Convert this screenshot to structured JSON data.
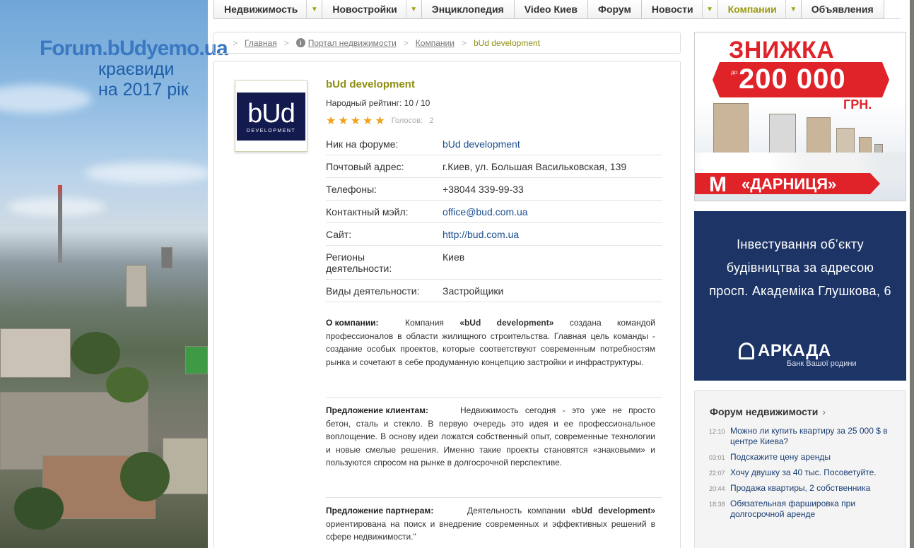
{
  "brand": {
    "site": "Forum.bUdyemo.ua",
    "tagline_line1": "краєвиди",
    "tagline_line2": "на 2017 рік"
  },
  "nav": [
    {
      "label": "Недвижимость",
      "arrow": true,
      "active": false
    },
    {
      "label": "Новостройки",
      "arrow": true,
      "active": false
    },
    {
      "label": "Энциклопедия",
      "arrow": false,
      "active": false
    },
    {
      "label": "Video Киев",
      "arrow": false,
      "active": false
    },
    {
      "label": "Форум",
      "arrow": false,
      "active": false
    },
    {
      "label": "Новости",
      "arrow": true,
      "active": false
    },
    {
      "label": "Компании",
      "arrow": true,
      "active": true
    },
    {
      "label": "Объявления",
      "arrow": false,
      "active": false
    }
  ],
  "breadcrumb": {
    "home": "Главная",
    "portal": "Портал недвижимости",
    "companies": "Компании",
    "current": "bUd development"
  },
  "company": {
    "name": "bUd development",
    "logo_big": "bUd",
    "logo_small": "DEVELOPMENT",
    "rating_label": "Народный рейтинг:",
    "rating_value": "10 / 10",
    "stars": 5,
    "votes_label": "Голосов:",
    "votes": "2",
    "fields": [
      {
        "key": "Ник на форуме:",
        "value": "bUd development",
        "link": true
      },
      {
        "key": "Почтовый адрес:",
        "value": "г.Киев, ул. Большая Васильковская, 139",
        "link": false
      },
      {
        "key": "Телефоны:",
        "value": "+38044 339-99-33",
        "link": false
      },
      {
        "key": "Контактный мэйл:",
        "value": "office@bud.com.ua",
        "link": true
      },
      {
        "key": "Сайт:",
        "value": "http://bud.com.ua",
        "link": true
      },
      {
        "key": "Регионы деятельности:",
        "value": "Киев",
        "link": false
      },
      {
        "key": "Виды деятельности:",
        "value": "Застройщики",
        "link": false
      }
    ],
    "about_heading": "О компании:",
    "about_text_a": "Компания ",
    "about_text_b": "«bUd development»",
    "about_text_c": " создана командой профессионалов в области жилищного строительства. Главная цель команды - создание особых проектов, которые соответствуют современным потребностям рынка и сочетают в себе продуманную концепцию застройки и инфраструктуры.",
    "clients_heading": "Предложение клиентам:",
    "clients_text": "Недвижимость сегодня - это уже не просто бетон, сталь и стекло. В первую очередь это идея и ее профессиональное воплощение. В основу идеи ложатся собственный опыт, современные технологии и новые смелые решения. Именно такие проекты становятся «знаковыми» и пользуются спросом на рынке в долгосрочной перспективе.",
    "partners_heading": "Предложение партнерам:",
    "partners_text_a": "Деятельность компании ",
    "partners_text_b": "«bUd development»",
    "partners_text_c": " ориентирована на поиск и внедрение современных и эффективных решений в сфере недвижимости.\""
  },
  "ad1": {
    "discount": "ЗНИЖКА",
    "upto": "до",
    "amount": "200 000",
    "currency": "ГРН.",
    "metro_mark": "M",
    "metro_name": "«ДАРНИЦЯ»",
    "accent": "#e02229"
  },
  "ad2": {
    "line1": "Інвестування об’єкту",
    "line2": "будівництва за адресою",
    "line3": "просп. Академіка Глушкова, 6",
    "brand": "АРКАДА",
    "bank": "Банк Вашої родини",
    "bg": "#1d3566"
  },
  "forum": {
    "title": "Форум недвижимости",
    "items": [
      {
        "time": "12:10",
        "text": "Можно ли купить квартиру за 25 000 $ в центре Киева?"
      },
      {
        "time": "03:01",
        "text": "Подскажите цену аренды"
      },
      {
        "time": "22:07",
        "text": "Хочу двушку за 40 тыс. Посоветуйте."
      },
      {
        "time": "20:44",
        "text": "Продажа квартиры, 2 собственника"
      },
      {
        "time": "18:38",
        "text": "Обязательная фаршировка при долгосрочной аренде"
      }
    ]
  }
}
